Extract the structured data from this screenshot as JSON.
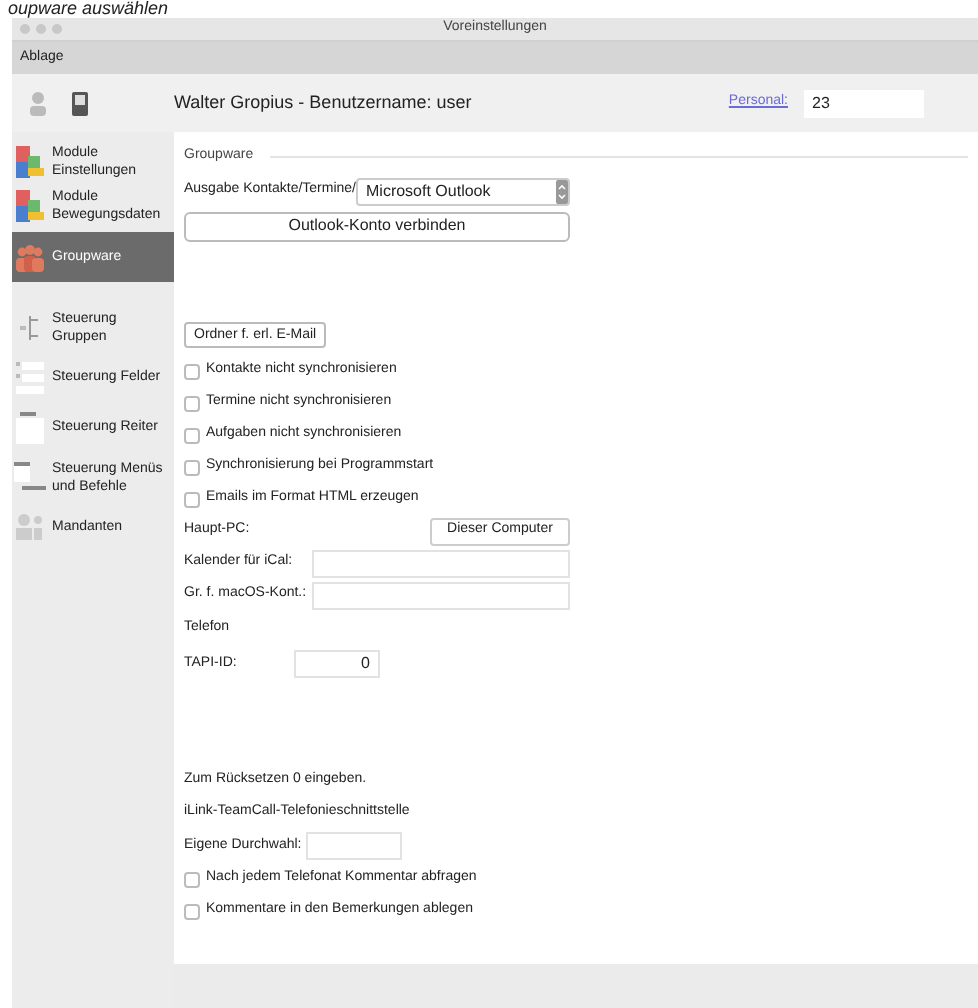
{
  "caption": "oupware auswählen",
  "window": {
    "title": "Voreinstellungen"
  },
  "menu": [
    "Ablage"
  ],
  "toolbar": {
    "user": "Walter Gropius - Benutzername: user",
    "personal_link": "Personal:",
    "personal_value": "23"
  },
  "sidebar": {
    "items": [
      {
        "label": "Module Einstellungen",
        "selected": false
      },
      {
        "label": "Module Bewegungsdaten",
        "selected": false
      },
      {
        "label": "Groupware",
        "selected": true
      },
      {
        "label": "Steuerung Gruppen",
        "selected": false
      },
      {
        "label": "Steuerung Felder",
        "selected": false
      },
      {
        "label": "Steuerung Reiter",
        "selected": false
      },
      {
        "label": "Steuerung Menüs und Befehle",
        "selected": false
      },
      {
        "label": "Mandanten",
        "selected": false
      }
    ]
  },
  "groupware": {
    "title": "Groupware",
    "output_label": "Ausgabe Kontakte/Termine/",
    "output_value": "Microsoft Outlook",
    "connect_button": "Outlook-Konto verbinden"
  },
  "settings": [
    {
      "kind": "button",
      "label": "Ordner f. erl. E-Mail"
    },
    {
      "kind": "checkbox",
      "label": "Kontakte nicht synchronisieren",
      "checked": false
    },
    {
      "kind": "checkbox",
      "label": "Termine nicht synchronisieren",
      "checked": false
    },
    {
      "kind": "checkbox",
      "label": "Aufgaben nicht synchronisieren",
      "checked": false
    },
    {
      "kind": "checkbox",
      "label": "Synchronisierung bei Programmstart",
      "checked": false
    },
    {
      "kind": "checkbox",
      "label": "Emails im Format HTML erzeugen",
      "checked": false
    },
    {
      "kind": "labelbutton",
      "label": "Haupt-PC:",
      "button": "Dieser Computer"
    },
    {
      "kind": "field",
      "label": "Kalender für iCal:"
    },
    {
      "kind": "field",
      "label": "Gr. f. macOS-Kont.:"
    },
    {
      "kind": "heading",
      "label": "Telefon"
    },
    {
      "kind": "number",
      "label": "TAPI-ID:",
      "value": "0"
    },
    {
      "kind": "spacer"
    },
    {
      "kind": "note",
      "label": "Zum Rücksetzen 0 eingeben."
    },
    {
      "kind": "note",
      "label": "iLink-TeamCall-Telefonieschnittstelle"
    },
    {
      "kind": "shortfield",
      "label": "Eigene Durchwahl:"
    },
    {
      "kind": "checkbox",
      "label": "Nach jedem Telefonat Kommentar abfragen",
      "checked": false
    },
    {
      "kind": "checkbox",
      "label": "Kommentare in den Bemerkungen ablegen",
      "checked": false
    }
  ]
}
